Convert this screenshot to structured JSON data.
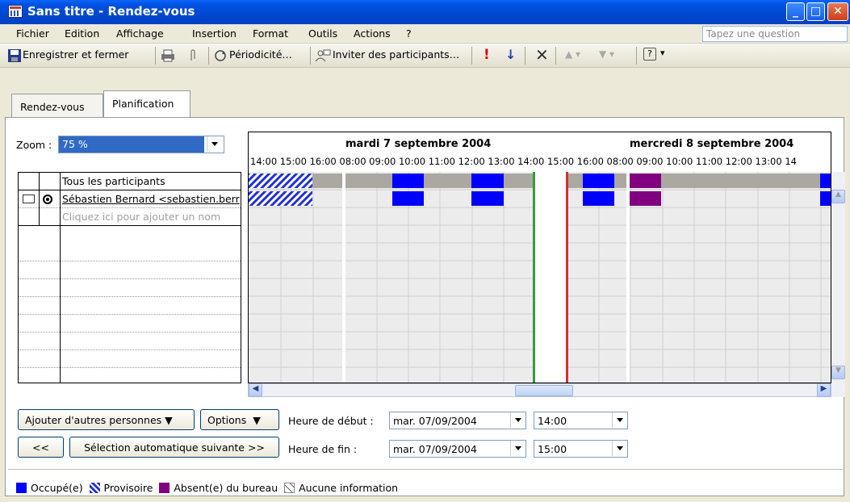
{
  "window": {
    "title": "Sans titre - Rendez-vous"
  },
  "menu": {
    "items": [
      "Fichier",
      "Edition",
      "Affichage",
      "Insertion",
      "Format",
      "Outils",
      "Actions",
      "?"
    ],
    "search_placeholder": "Tapez une question"
  },
  "toolbar": {
    "save_close": "Enregistrer et fermer",
    "recurrence": "Périodicité…",
    "invite": "Inviter des participants…"
  },
  "tabs": [
    {
      "label": "Rendez-vous"
    },
    {
      "label": "Planification"
    }
  ],
  "zoom": {
    "label": "Zoom :",
    "value": "75 %"
  },
  "participants": {
    "header": "Tous les participants",
    "rows": [
      {
        "name": "Sébastien Bernard <sebastien.berr"
      }
    ],
    "add_placeholder": "Cliquez ici pour ajouter un nom"
  },
  "schedule": {
    "days": [
      "mardi 7 septembre 2004",
      "mercredi 8 septembre 2004"
    ],
    "hours": "14:00 15:00 16:00 08:00 09:00 10:00 11:00 12:00 13:00 14:00 15:00 16:00 08:00 09:00 10:00 11:00 12:00 13:00 14",
    "colors": {
      "busy": "#0000ff",
      "tentative": "#1f2fd8",
      "oof": "#800080",
      "free_band": "#aaa8a0",
      "start_line": "#3a9a3a",
      "end_line": "#d03030"
    }
  },
  "controls": {
    "add_others": "Ajouter d'autres personnes",
    "options": "Options",
    "prev": "<<",
    "autopick_next": "Sélection automatique suivante >>",
    "start_label": "Heure de début :",
    "end_label": "Heure de fin :",
    "start_date": "mar. 07/09/2004",
    "start_time": "14:00",
    "end_date": "mar. 07/09/2004",
    "end_time": "15:00"
  },
  "legend": {
    "busy": "Occupé(e)",
    "tentative": "Provisoire",
    "oof": "Absent(e) du bureau",
    "no_info": "Aucune information"
  }
}
